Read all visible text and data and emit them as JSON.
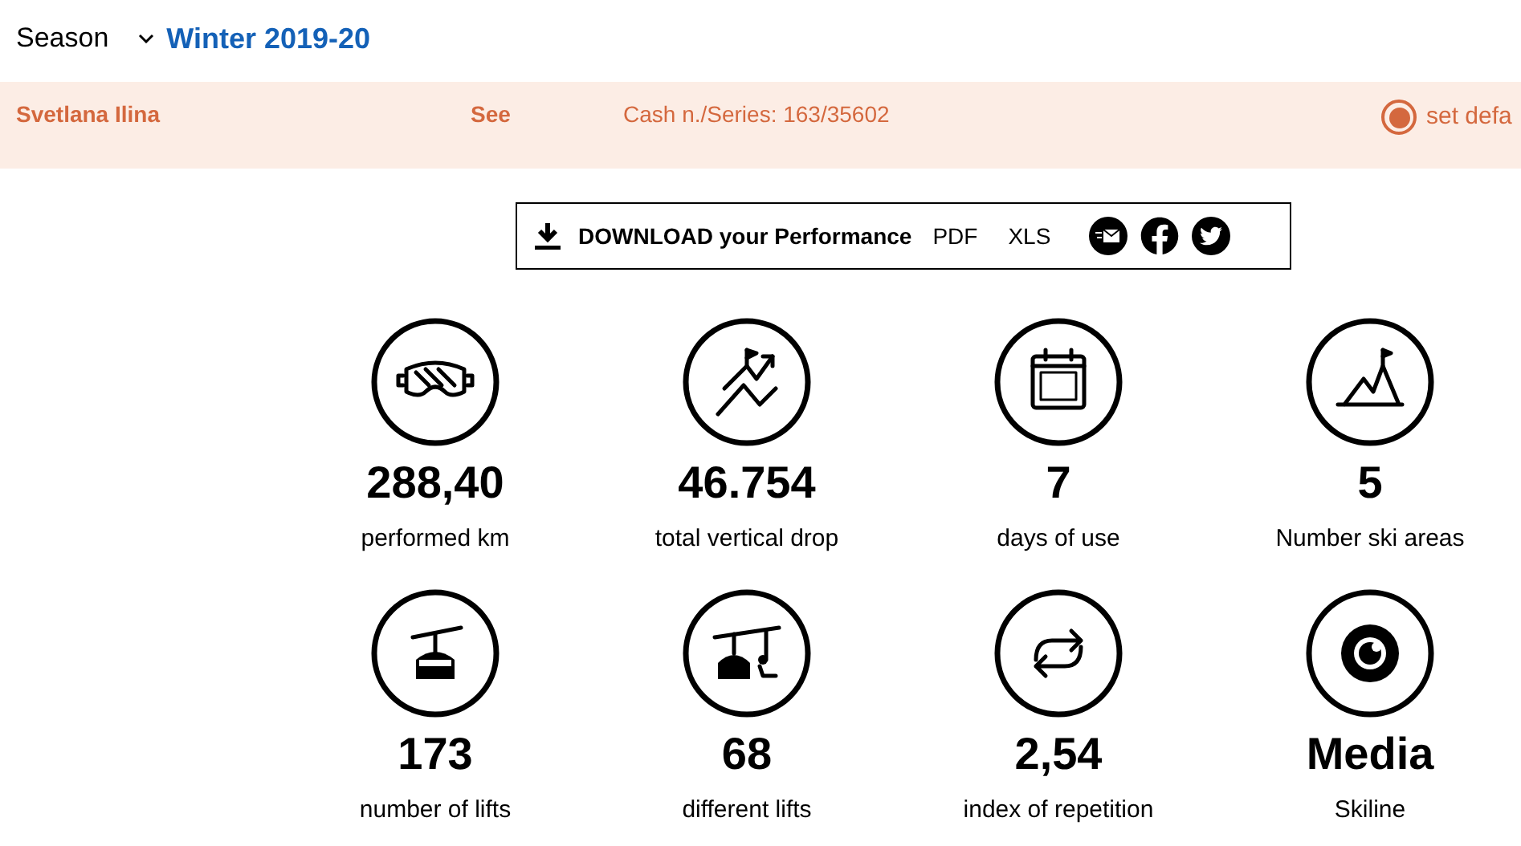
{
  "season": {
    "label": "Season",
    "value": "Winter 2019-20"
  },
  "card": {
    "name": "Svetlana Ilina",
    "link": "See",
    "cash": "Cash n./Series: 163/35602",
    "radio": {
      "label": "set defa",
      "selected": true
    }
  },
  "download": {
    "label": "DOWNLOAD your Performance",
    "formats": [
      "PDF",
      "XLS"
    ]
  },
  "stats": [
    {
      "value": "288,40",
      "label": "performed km"
    },
    {
      "value": "46.754",
      "label": "total vertical drop"
    },
    {
      "value": "7",
      "label": "days of use"
    },
    {
      "value": "5",
      "label": "Number ski areas"
    },
    {
      "value": "173",
      "label": "number of lifts"
    },
    {
      "value": "68",
      "label": "different lifts"
    },
    {
      "value": "2,54",
      "label": "index of repetition"
    },
    {
      "value": "Media",
      "label": "Skiline"
    }
  ]
}
